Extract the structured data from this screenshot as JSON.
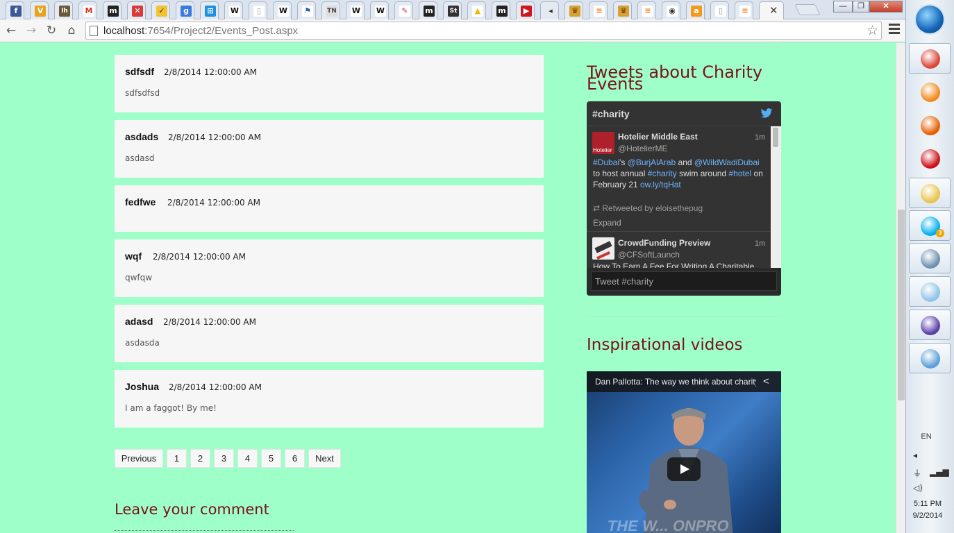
{
  "browser": {
    "tabs": [
      {
        "icon": "facebook-icon",
        "glyph": "f",
        "color": "#3b5998",
        "fg": "#ffffff"
      },
      {
        "icon": "vimeo-icon",
        "glyph": "V",
        "color": "#e9a21e",
        "fg": "#ffffff"
      },
      {
        "icon": "lh-icon",
        "glyph": "lh",
        "color": "#6b5a3a",
        "fg": "#ffffff"
      },
      {
        "icon": "gmail-icon",
        "glyph": "M",
        "color": "#ffffff",
        "fg": "#d93025"
      },
      {
        "icon": "m-icon",
        "glyph": "m",
        "color": "#222222",
        "fg": "#ffffff"
      },
      {
        "icon": "red-x-icon",
        "glyph": "✕",
        "color": "#d93a3a",
        "fg": "#ffffff"
      },
      {
        "icon": "check-icon",
        "glyph": "✓",
        "color": "#f2c230",
        "fg": "#333333"
      },
      {
        "icon": "google-icon",
        "glyph": "g",
        "color": "#3b7be0",
        "fg": "#ffffff"
      },
      {
        "icon": "windows-icon",
        "glyph": "⊞",
        "color": "#1e90e0",
        "fg": "#ffffff"
      },
      {
        "icon": "wikipedia-icon",
        "glyph": "W",
        "color": "#ffffff",
        "fg": "#111111"
      },
      {
        "icon": "page-icon",
        "glyph": "▯",
        "color": "#ffffff",
        "fg": "#999999"
      },
      {
        "icon": "wikipedia-icon",
        "glyph": "W",
        "color": "#ffffff",
        "fg": "#111111"
      },
      {
        "icon": "flag-icon",
        "glyph": "⚑",
        "color": "#ffffff",
        "fg": "#2a5fb0"
      },
      {
        "icon": "tn-icon",
        "glyph": "TN",
        "color": "#dddddd",
        "fg": "#444444"
      },
      {
        "icon": "wikipedia-icon",
        "glyph": "W",
        "color": "#ffffff",
        "fg": "#111111"
      },
      {
        "icon": "wikipedia-icon",
        "glyph": "W",
        "color": "#ffffff",
        "fg": "#111111"
      },
      {
        "icon": "pencil-icon",
        "glyph": "✎",
        "color": "#ffffff",
        "fg": "#cc3377"
      },
      {
        "icon": "m-icon",
        "glyph": "m",
        "color": "#222222",
        "fg": "#ffffff"
      },
      {
        "icon": "st-icon",
        "glyph": "St",
        "color": "#333333",
        "fg": "#ffffff"
      },
      {
        "icon": "drive-icon",
        "glyph": "▲",
        "color": "#ffffff",
        "fg": "#f2b400"
      },
      {
        "icon": "m-icon",
        "glyph": "m",
        "color": "#222222",
        "fg": "#ffffff"
      },
      {
        "icon": "youtube-icon",
        "glyph": "▶",
        "color": "#cc181e",
        "fg": "#ffffff"
      },
      {
        "icon": "speaker-icon",
        "glyph": "◂",
        "color": "#e4eaf2",
        "fg": "#333333"
      },
      {
        "icon": "emblem-icon",
        "glyph": "♛",
        "color": "#d8a030",
        "fg": "#5a3a00"
      },
      {
        "icon": "stack-icon",
        "glyph": "≡",
        "color": "#ffffff",
        "fg": "#f48024"
      },
      {
        "icon": "emblem-icon",
        "glyph": "♛",
        "color": "#d8a030",
        "fg": "#5a3a00"
      },
      {
        "icon": "stack-icon",
        "glyph": "≡",
        "color": "#ffffff",
        "fg": "#f48024"
      },
      {
        "icon": "circle-icon",
        "glyph": "◉",
        "color": "#ffffff",
        "fg": "#333333"
      },
      {
        "icon": "orange-a-icon",
        "glyph": "a",
        "color": "#f29a1e",
        "fg": "#ffffff"
      },
      {
        "icon": "page-icon",
        "glyph": "▯",
        "color": "#ffffff",
        "fg": "#999999"
      },
      {
        "icon": "stack-icon",
        "glyph": "≡",
        "color": "#ffffff",
        "fg": "#f48024"
      }
    ],
    "active_tab_close": "✕",
    "window_buttons": {
      "minimize": "—",
      "maximize": "❐",
      "close": "✕"
    },
    "nav": {
      "back": "←",
      "forward": "→",
      "reload": "↻",
      "home": "⌂"
    },
    "url_host": "localhost",
    "url_path": ":7654/Project2/Events_Post.aspx",
    "star": "☆"
  },
  "comments": [
    {
      "author": "sdfsdf",
      "date": "2/8/2014 12:00:00 AM",
      "body": "sdfsdfsd"
    },
    {
      "author": "asdads",
      "date": "2/8/2014 12:00:00 AM",
      "body": "asdasd"
    },
    {
      "author": "fedfwe",
      "date": "2/8/2014 12:00:00 AM",
      "body": ""
    },
    {
      "author": "wqf",
      "date": "2/8/2014 12:00:00 AM",
      "body": "qwfqw"
    },
    {
      "author": "adasd",
      "date": "2/8/2014 12:00:00 AM",
      "body": "asdasda"
    },
    {
      "author": "Joshua",
      "date": "2/8/2014 12:00:00 AM",
      "body": "I am a faggot! By me!"
    }
  ],
  "pagination": {
    "previous": "Previous",
    "pages": [
      "1",
      "2",
      "3",
      "4",
      "5",
      "6"
    ],
    "next": "Next"
  },
  "leave_comment_title": "Leave your comment",
  "sidebar": {
    "tweets_title": "Tweets about Charity Events",
    "twitter_widget": {
      "hashtag": "#charity",
      "tweets": [
        {
          "name": "Hotelier Middle East",
          "handle": "@HotelierME",
          "time": "1m",
          "avatar_text": "Hotelier",
          "avatar_color": "#b0202a",
          "text_parts": [
            {
              "t": "#Dubai",
              "link": true
            },
            {
              "t": "'s ",
              "link": false
            },
            {
              "t": "@BurjAlArab",
              "link": true
            },
            {
              "t": "  and ",
              "link": false
            },
            {
              "t": "@WildWadiDubai",
              "link": true
            },
            {
              "t": " to host annual ",
              "link": false
            },
            {
              "t": "#charity",
              "link": true
            },
            {
              "t": " swim around ",
              "link": false
            },
            {
              "t": "#hotel",
              "link": true
            },
            {
              "t": " on February 21 ",
              "link": false
            },
            {
              "t": "ow.ly/tqHat",
              "link": true
            }
          ],
          "retweeted_by": "Retweeted by eloisethepug",
          "expand": "Expand"
        },
        {
          "name": "CrowdFunding Preview",
          "handle": "@CFSoftLaunch",
          "time": "1m",
          "avatar_color": "#eeeeee",
          "text": "How To Earn A Fee For Writing A Charitable"
        }
      ],
      "tweet_box_placeholder": "Tweet #charity"
    },
    "videos_title": "Inspirational videos",
    "video": {
      "caption": "Dan Pallotta: The way we think about charity is dead wrong",
      "share": "<",
      "stage_text": "THE W... ONPRO"
    }
  },
  "taskbar": {
    "apps": [
      {
        "name": "chrome-icon",
        "color": "#db4437",
        "boxed": true
      },
      {
        "name": "media-player-icon",
        "color": "#f08a1c",
        "boxed": false
      },
      {
        "name": "firefox-icon",
        "color": "#e66000",
        "boxed": false
      },
      {
        "name": "opera-icon",
        "color": "#cc0f16",
        "boxed": false
      },
      {
        "name": "file-explorer-icon",
        "color": "#e8c54a",
        "boxed": true
      },
      {
        "name": "skype-icon",
        "color": "#00aff0",
        "boxed": true,
        "badge": "3"
      },
      {
        "name": "tools-icon",
        "color": "#6f8fb0",
        "boxed": true
      },
      {
        "name": "notepad-icon",
        "color": "#8fc3e8",
        "boxed": true
      },
      {
        "name": "visual-studio-icon",
        "color": "#5b3ea8",
        "boxed": true
      },
      {
        "name": "paint-icon",
        "color": "#5aa0d8",
        "boxed": true
      }
    ],
    "language": "EN",
    "time": "5:11 PM",
    "date": "9/2/2014"
  }
}
